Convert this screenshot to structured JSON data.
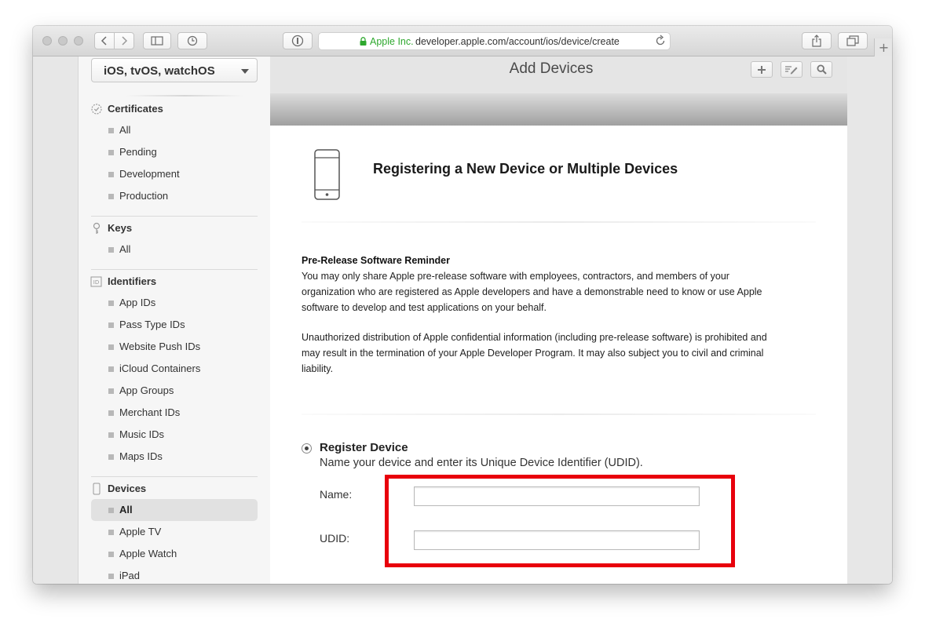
{
  "browser": {
    "address": {
      "org": "Apple Inc.",
      "url": "developer.apple.com/account/ios/device/create"
    },
    "new_tab_symbol": "+"
  },
  "sidebar": {
    "platform": "iOS, tvOS, watchOS",
    "sections": [
      {
        "title": "Certificates",
        "icon": "certificate-icon",
        "items": [
          "All",
          "Pending",
          "Development",
          "Production"
        ]
      },
      {
        "title": "Keys",
        "icon": "key-icon",
        "items": [
          "All"
        ]
      },
      {
        "title": "Identifiers",
        "icon": "id-icon",
        "items": [
          "App IDs",
          "Pass Type IDs",
          "Website Push IDs",
          "iCloud Containers",
          "App Groups",
          "Merchant IDs",
          "Music IDs",
          "Maps IDs"
        ]
      },
      {
        "title": "Devices",
        "icon": "device-icon",
        "items": [
          "All",
          "Apple TV",
          "Apple Watch",
          "iPad"
        ],
        "active_item": "All"
      }
    ]
  },
  "main": {
    "title": "Add Devices",
    "heading": "Registering a New Device or Multiple Devices",
    "reminder_title": "Pre-Release Software Reminder",
    "reminder_lines": [
      "You may only share Apple pre-release software with employees, contractors, and members of your",
      "organization who are registered as Apple developers and have a demonstrable need to know or use Apple",
      "software to develop and test applications on your behalf."
    ],
    "warning_lines": [
      "Unauthorized distribution of Apple confidential information (including pre-release software) is prohibited and",
      "may result in the termination of your Apple Developer Program. It may also subject you to civil and criminal",
      "liability."
    ],
    "register": {
      "label": "Register Device",
      "description": "Name your device and enter its Unique Device Identifier (UDID).",
      "name_label": "Name:",
      "udid_label": "UDID:",
      "name_value": "",
      "udid_value": ""
    }
  },
  "colors": {
    "highlight_box": "#e8000c",
    "secure_green": "#2ea82e"
  }
}
